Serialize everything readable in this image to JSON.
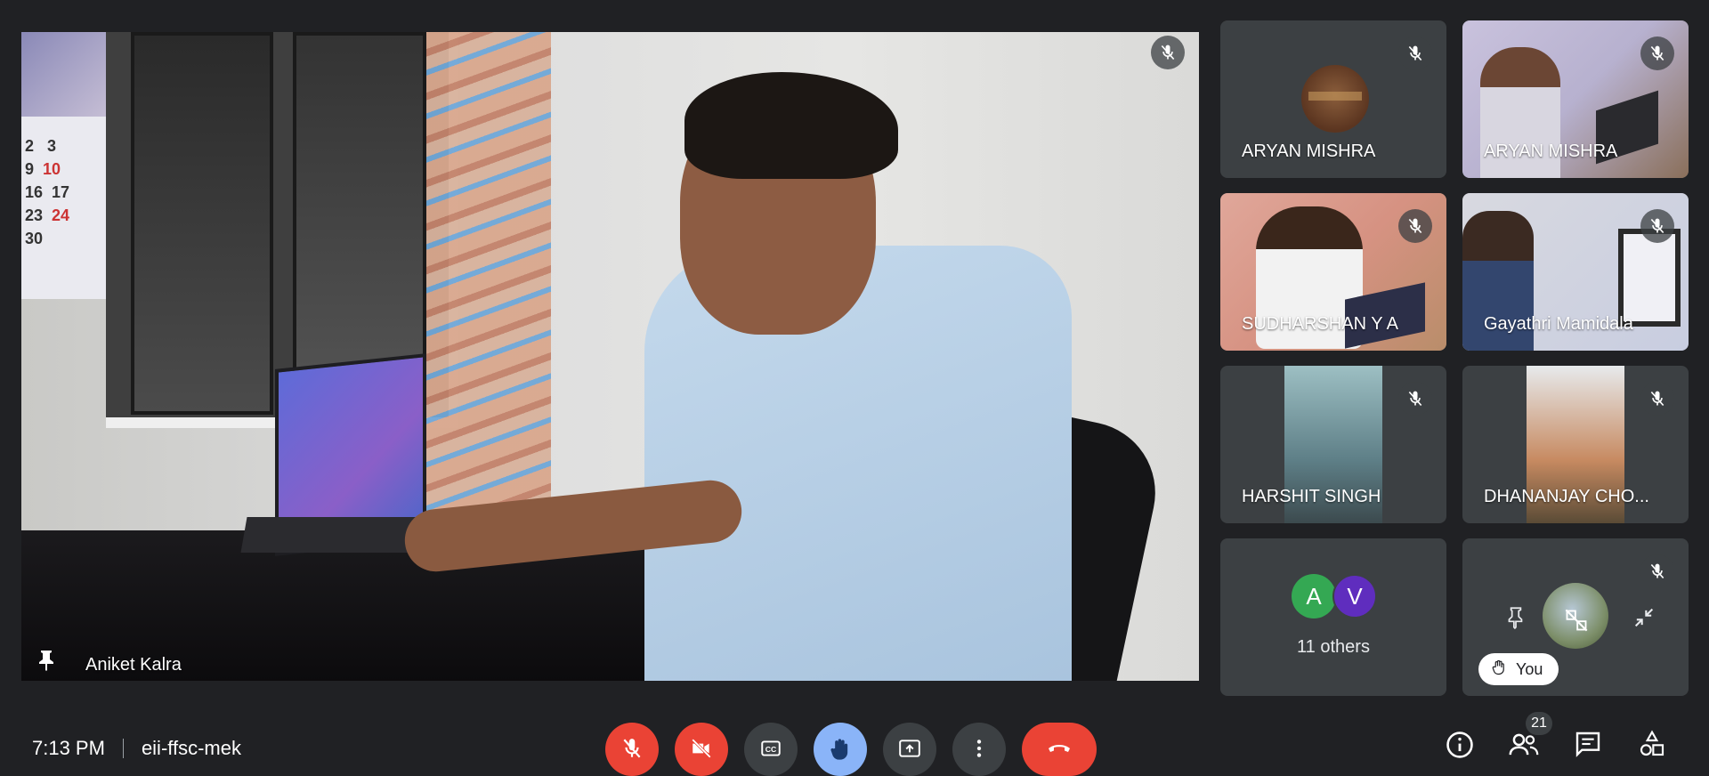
{
  "main_tile": {
    "participant_name": "Aniket Kalra",
    "pinned": true,
    "muted": true,
    "calendar_numbers": [
      "2",
      "3",
      "9",
      "10",
      "16",
      "17",
      "23",
      "24",
      "30"
    ]
  },
  "grid_tiles": [
    {
      "name": "ARYAN MISHRA",
      "muted": true,
      "type": "avatar"
    },
    {
      "name": "ARYAN MISHRA",
      "muted": true,
      "type": "video"
    },
    {
      "name": "SUDHARSHAN Y A",
      "muted": true,
      "type": "video"
    },
    {
      "name": "Gayathri Mamidala",
      "muted": true,
      "type": "video"
    },
    {
      "name": "HARSHIT SINGH",
      "muted": true,
      "type": "video"
    },
    {
      "name": "DHANANJAY CHO...",
      "muted": true,
      "type": "video"
    }
  ],
  "others_tile": {
    "avatars": [
      "A",
      "V"
    ],
    "label": "11 others",
    "colors": [
      "#34a853",
      "#5f2dbe"
    ]
  },
  "self_tile": {
    "chip_label": "You",
    "hand_raised": true,
    "muted": true
  },
  "bottom_bar": {
    "time": "7:13 PM",
    "meeting_code": "eii-ffsc-mek",
    "controls": [
      {
        "name": "microphone-off",
        "icon": "mic-off-icon",
        "color": "#ea4335"
      },
      {
        "name": "camera-off",
        "icon": "videocam-off-icon",
        "color": "#ea4335"
      },
      {
        "name": "captions",
        "icon": "closed-caption-icon",
        "color": "#3c4043"
      },
      {
        "name": "raise-hand",
        "icon": "hand-icon",
        "color": "#8ab4f8"
      },
      {
        "name": "present",
        "icon": "present-to-all-icon",
        "color": "#3c4043"
      },
      {
        "name": "more-options",
        "icon": "more-vert-icon",
        "color": "#3c4043"
      },
      {
        "name": "leave-call",
        "icon": "call-end-icon",
        "color": "#ea4335"
      }
    ],
    "right_icons": [
      "info-icon",
      "people-icon",
      "chat-icon",
      "activities-icon"
    ],
    "participant_count": "21"
  }
}
